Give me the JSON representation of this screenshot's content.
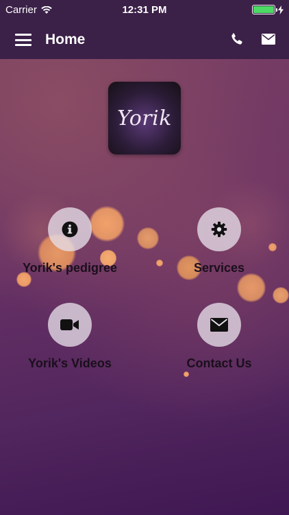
{
  "status_bar": {
    "carrier": "Carrier",
    "time": "12:31 PM",
    "battery_color": "#4cd964"
  },
  "nav": {
    "title": "Home",
    "menu_icon": "hamburger-menu-icon",
    "actions": [
      {
        "icon": "phone-icon"
      },
      {
        "icon": "mail-icon"
      }
    ]
  },
  "logo": {
    "text": "Yorik"
  },
  "tiles": [
    {
      "label": "Yorik's pedigree",
      "icon": "info-icon"
    },
    {
      "label": "Services",
      "icon": "gear-icon"
    },
    {
      "label": "Yorik's Videos",
      "icon": "video-camera-icon"
    },
    {
      "label": "Contact Us",
      "icon": "envelope-icon"
    }
  ],
  "colors": {
    "bar_background": "#3b2048",
    "tile_circle": "#e6dee8",
    "label_text": "#1a0f1c"
  }
}
